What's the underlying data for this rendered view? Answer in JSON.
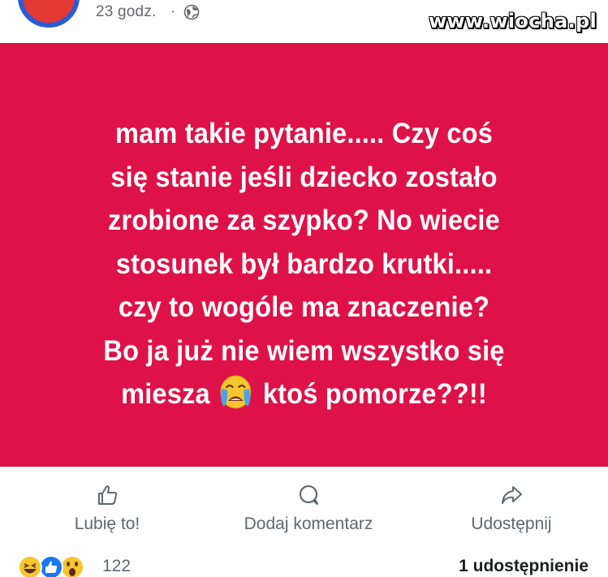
{
  "header": {
    "timestamp": "23 godz.",
    "separator": "·",
    "privacy_icon": "globe-icon",
    "watermark": "www.wiocha.pl"
  },
  "post": {
    "background_color": "#de1248",
    "text_color": "#ffffff",
    "lines": [
      "mam takie pytanie..... Czy coś",
      "się stanie jeśli dziecko zostało",
      "zrobione za szypko? No wiecie",
      "stosunek był bardzo krutki.....",
      "czy to wogóle ma znaczenie?",
      "Bo ja już nie wiem wszystko się"
    ],
    "last_line_before_emoji": "miesza",
    "emoji": "crying-face-emoji",
    "last_line_after_emoji": "ktoś pomorze??!!"
  },
  "actions": {
    "like_label": "Lubię to!",
    "like_icon": "thumbs-up-icon",
    "comment_label": "Dodaj komentarz",
    "comment_icon": "comment-bubble-icon",
    "share_label": "Udostępnij",
    "share_icon": "share-arrow-icon"
  },
  "reactions": {
    "icons": [
      "haha-reaction-icon",
      "like-reaction-icon",
      "wow-reaction-icon"
    ],
    "count": "122",
    "shares": "1 udostępnienie"
  }
}
